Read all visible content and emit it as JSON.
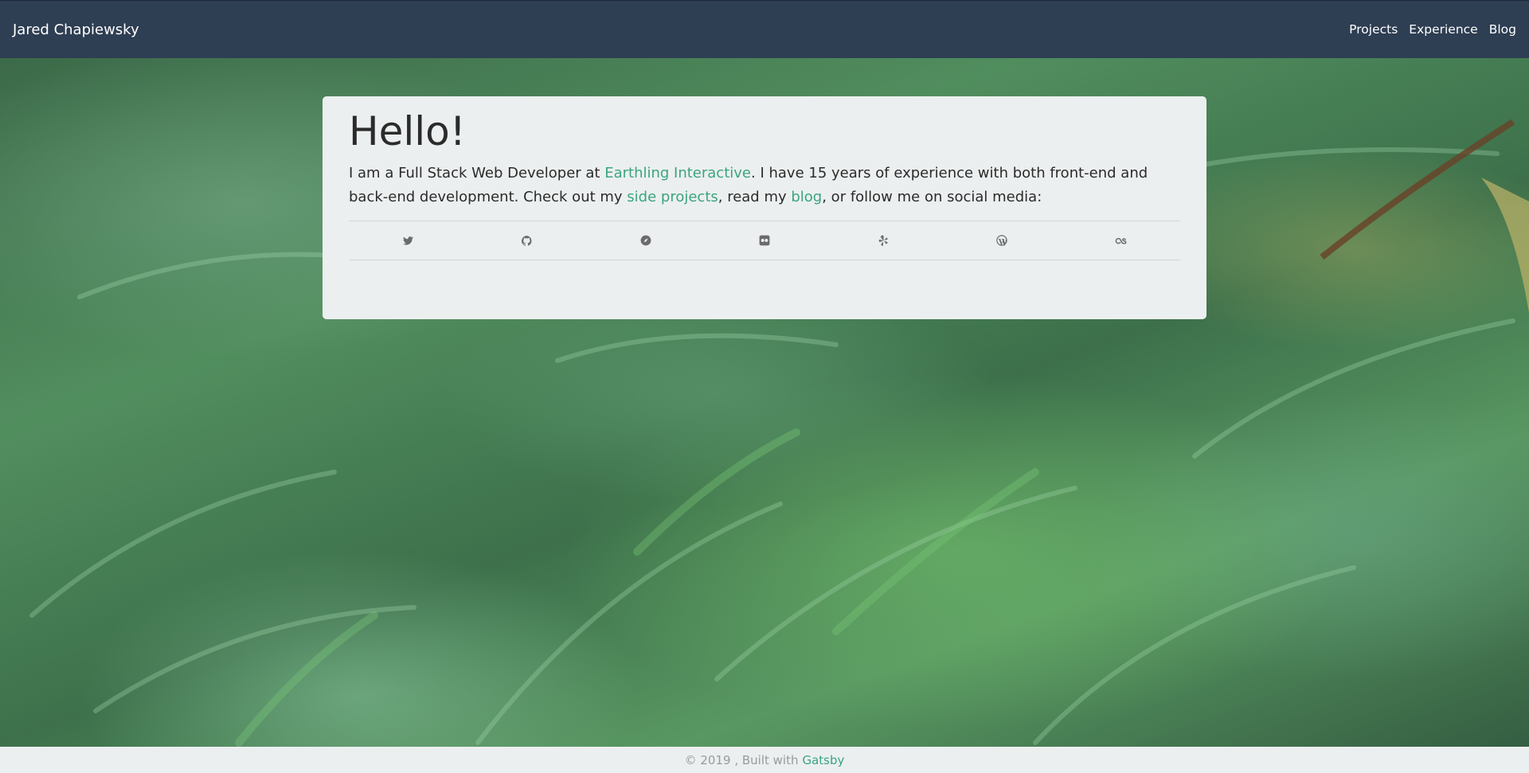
{
  "nav": {
    "brand": "Jared Chapiewsky",
    "links": [
      {
        "label": "Projects"
      },
      {
        "label": "Experience"
      },
      {
        "label": "Blog"
      }
    ]
  },
  "card": {
    "heading": "Hello!",
    "intro": {
      "part1": "I am a Full Stack Web Developer at ",
      "company_link": "Earthling Interactive",
      "part2": ". I have 15 years of experience with both front-end and back-end development. Check out my ",
      "projects_link": "side projects",
      "part3": ", read my ",
      "blog_link": "blog",
      "part4": ", or follow me on social media:"
    },
    "social": [
      {
        "icon": "twitter-icon"
      },
      {
        "icon": "github-icon"
      },
      {
        "icon": "compass-icon"
      },
      {
        "icon": "flickr-icon"
      },
      {
        "icon": "yelp-icon"
      },
      {
        "icon": "wordpress-icon"
      },
      {
        "icon": "lastfm-icon"
      }
    ]
  },
  "footer": {
    "text": "© 2019 , Built with",
    "link": "Gatsby"
  },
  "colors": {
    "navbar": "#2e3e53",
    "accent": "#3aa57f",
    "card": "#ecefef",
    "footer": "#eceff0"
  }
}
